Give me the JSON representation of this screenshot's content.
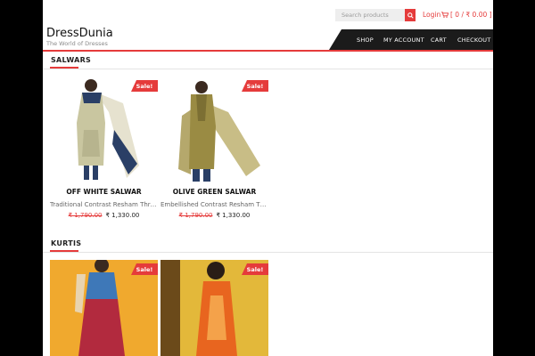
{
  "header": {
    "search_placeholder": "Search products",
    "login_label": "Login",
    "cart_summary": "[ 0 / ₹ 0.00 ]",
    "brand_name": "DressDunia",
    "tagline": "The World of Dresses"
  },
  "nav": {
    "shop": "SHOP",
    "account": "MY ACCOUNT",
    "cart": "CART",
    "checkout": "CHECKOUT"
  },
  "sections": [
    {
      "title": "SALWARS",
      "products": [
        {
          "sale_badge": "Sale!",
          "name": "OFF WHITE SALWAR",
          "description": "Traditional Contrast Resham Thre...",
          "old_price": "₹ 1,790.00",
          "new_price": "₹ 1,330.00"
        },
        {
          "sale_badge": "Sale!",
          "name": "OLIVE GREEN SALWAR",
          "description": "Embellished Contrast Resham Thr...",
          "old_price": "₹ 1,790.00",
          "new_price": "₹ 1,330.00"
        }
      ]
    },
    {
      "title": "KURTIS",
      "products": [
        {
          "sale_badge": "Sale!"
        },
        {
          "sale_badge": "Sale!"
        }
      ]
    }
  ],
  "colors": {
    "accent": "#e53b3b",
    "nav_bg": "#1b1b1b",
    "frame": "#000000"
  },
  "icons": {
    "search": "search-icon",
    "cart": "cart-icon"
  }
}
